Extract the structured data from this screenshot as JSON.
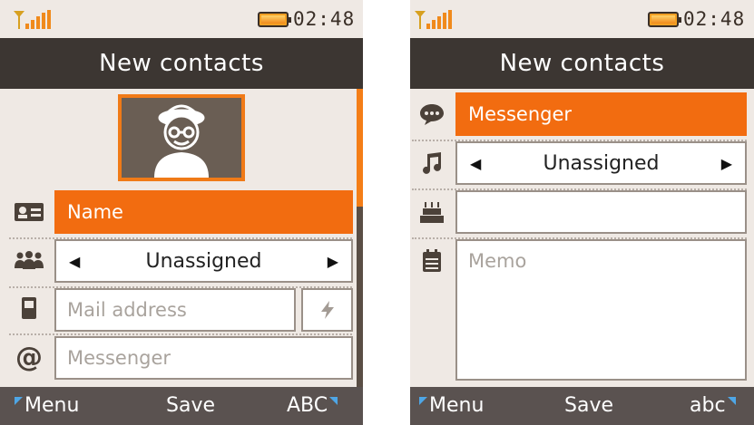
{
  "screens": [
    {
      "status": {
        "clock": "02:48"
      },
      "title": "New contacts",
      "fields": {
        "name_label": "Name",
        "group_value": "Unassigned",
        "mail_placeholder": "Mail address",
        "messenger_placeholder": "Messenger"
      },
      "softkeys": {
        "left": "Menu",
        "center": "Save",
        "right": "ABC"
      }
    },
    {
      "status": {
        "clock": "02:48"
      },
      "title": "New contacts",
      "fields": {
        "messenger_label": "Messenger",
        "ringtone_value": "Unassigned",
        "birthday_value": "",
        "memo_placeholder": "Memo"
      },
      "softkeys": {
        "left": "Menu",
        "center": "Save",
        "right": "abc"
      }
    }
  ],
  "colors": {
    "accent": "#f26c10",
    "title_bar": "#3c3632",
    "background": "#efe9e4",
    "softkey_bar": "#5a5250"
  },
  "icons": [
    "signal-icon",
    "battery-icon",
    "avatar-icon",
    "contact-card-icon",
    "group-icon",
    "phone-icon",
    "at-sign-icon",
    "flash-icon",
    "chat-bubble-icon",
    "music-note-icon",
    "birthday-cake-icon",
    "calendar-icon",
    "arrow-left-icon",
    "arrow-right-icon"
  ]
}
